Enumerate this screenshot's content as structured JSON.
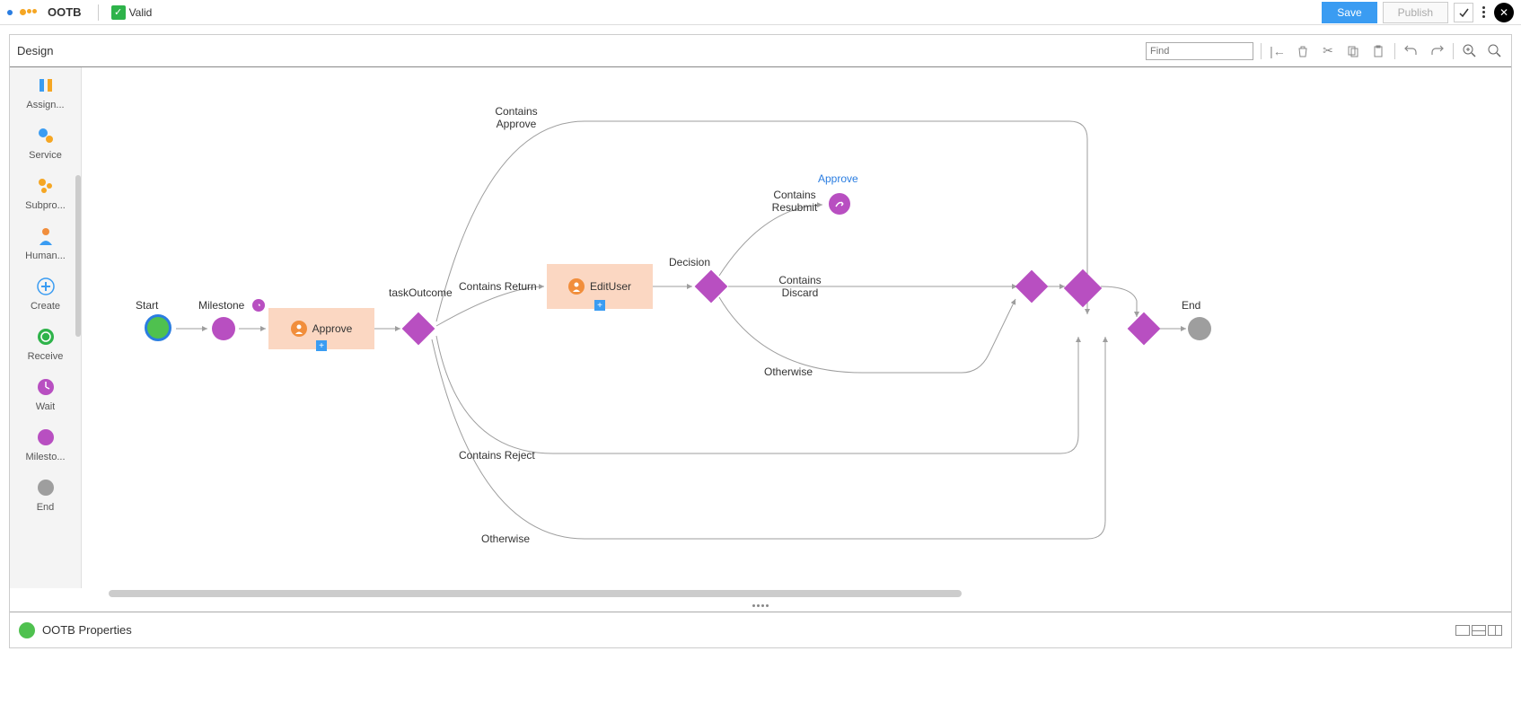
{
  "header": {
    "title": "OOTB",
    "valid_label": "Valid",
    "save_label": "Save",
    "publish_label": "Publish"
  },
  "toolbar": {
    "title": "Design",
    "find_placeholder": "Find"
  },
  "palette": [
    {
      "label": "Assign..."
    },
    {
      "label": "Service"
    },
    {
      "label": "Subpro..."
    },
    {
      "label": "Human..."
    },
    {
      "label": "Create"
    },
    {
      "label": "Receive"
    },
    {
      "label": "Wait"
    },
    {
      "label": "Milesto..."
    },
    {
      "label": "End"
    }
  ],
  "nodes": {
    "start": "Start",
    "milestone": "Milestone",
    "approve": "Approve",
    "taskOutcome": "taskOutcome",
    "editUser": "EditUser",
    "decision": "Decision",
    "end": "End",
    "gotoApprove": "Approve"
  },
  "edges": {
    "containsApprove": "Contains Approve",
    "containsReturn": "Contains Return",
    "containsReject": "Contains Reject",
    "otherwise1": "Otherwise",
    "containsResubmit": "Contains Resubmit",
    "containsDiscard": "Contains Discard",
    "otherwise2": "Otherwise"
  },
  "props": {
    "title": "OOTB Properties"
  }
}
